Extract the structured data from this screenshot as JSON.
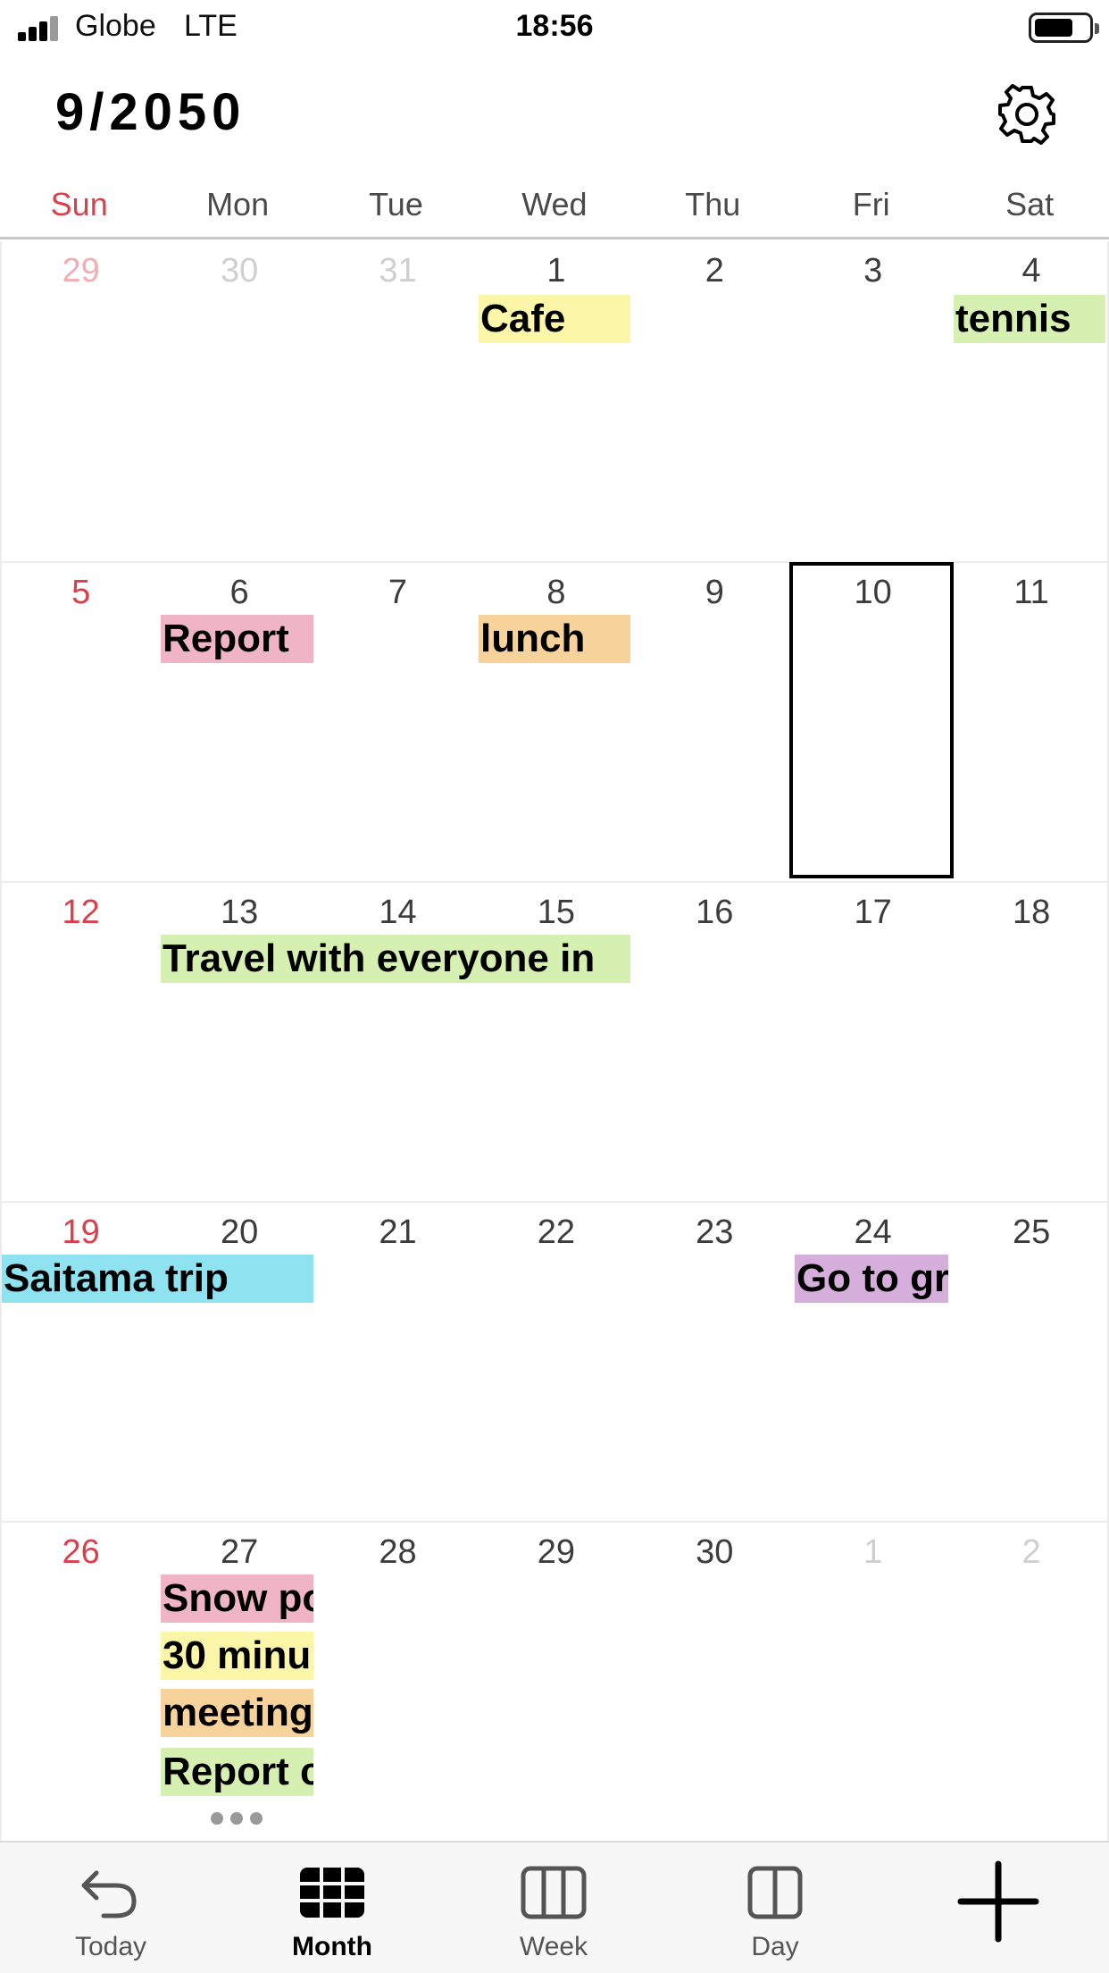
{
  "status_bar": {
    "carrier": "Globe",
    "network": "LTE",
    "time": "18:56"
  },
  "header": {
    "title": "9/2050",
    "settings_icon": "gear-icon"
  },
  "weekdays": [
    "Sun",
    "Mon",
    "Tue",
    "Wed",
    "Thu",
    "Fri",
    "Sat"
  ],
  "weeks": [
    {
      "days": [
        "29",
        "30",
        "31",
        "1",
        "2",
        "3",
        "4"
      ]
    },
    {
      "days": [
        "5",
        "6",
        "7",
        "8",
        "9",
        "10",
        "11"
      ]
    },
    {
      "days": [
        "12",
        "13",
        "14",
        "15",
        "16",
        "17",
        "18"
      ]
    },
    {
      "days": [
        "19",
        "20",
        "21",
        "22",
        "23",
        "24",
        "25"
      ]
    },
    {
      "days": [
        "26",
        "27",
        "28",
        "29",
        "30",
        "1",
        "2"
      ]
    }
  ],
  "events": {
    "cafe": "Cafe",
    "tennis": "tennis",
    "report": "Report",
    "lunch": "lunch",
    "travel": "Travel with everyone in",
    "saitama": "Saitama trip",
    "goto": "Go to gr",
    "snow": "Snow po",
    "thirty": "30 minu",
    "meeting": "meeting",
    "report2": "Report c"
  },
  "selected_day": "10",
  "tabs": {
    "today": "Today",
    "month": "Month",
    "week": "Week",
    "day": "Day"
  },
  "colors": {
    "sunday": "#d9404d",
    "yellow": "#fbf6a8",
    "green": "#d5f0b0",
    "pink": "#efb5c6",
    "orange": "#f7d39b",
    "cyan": "#8fe2f0",
    "purple": "#d5aedc"
  }
}
